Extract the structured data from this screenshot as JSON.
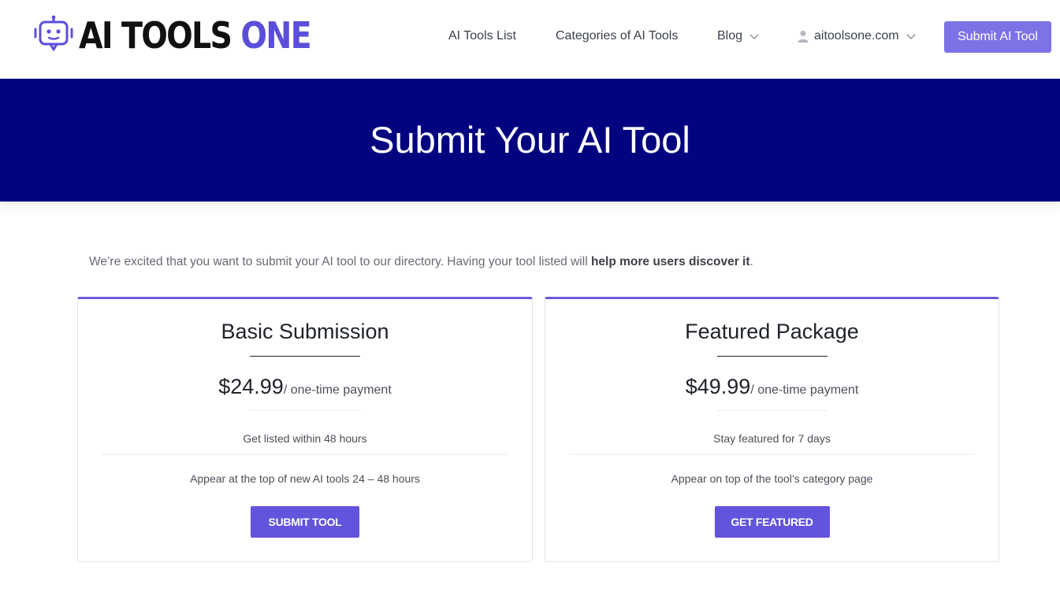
{
  "brand": {
    "name_main": "AI TOOLS",
    "name_accent": "ONE",
    "accent_color": "#5b4fd9"
  },
  "nav": {
    "items": [
      {
        "label": "AI Tools List"
      },
      {
        "label": "Categories of AI Tools"
      },
      {
        "label": "Blog",
        "icon": "chevron-down-icon"
      },
      {
        "label": "aitoolsone.com",
        "icon": "user-icon"
      }
    ],
    "submit_label": "Submit AI Tool"
  },
  "hero": {
    "title": "Submit Your AI Tool",
    "background": "#03037f"
  },
  "intro": {
    "text": "We’re excited that you want to submit your AI tool to our directory. Having your tool listed will ",
    "emphasis": "help more users discover it",
    "end": "."
  },
  "plans": [
    {
      "title": "Basic Submission",
      "price": "$24.99",
      "period": "/ one-time payment",
      "feature_1": "Get listed within 48 hours",
      "feature_2": "Appear at the top of new AI tools 24 – 48 hours",
      "cta": "SUBMIT TOOL"
    },
    {
      "title": "Featured Package",
      "price": "$49.99",
      "period": "/ one-time payment",
      "feature_1": "Stay featured for 7 days",
      "feature_2": "Appear on top of the tool’s category page",
      "cta": "GET FEATURED"
    }
  ],
  "colors": {
    "button": "#6254dc",
    "submit_button": "#7d73e6",
    "card_top_border": "#6a5ad8"
  }
}
